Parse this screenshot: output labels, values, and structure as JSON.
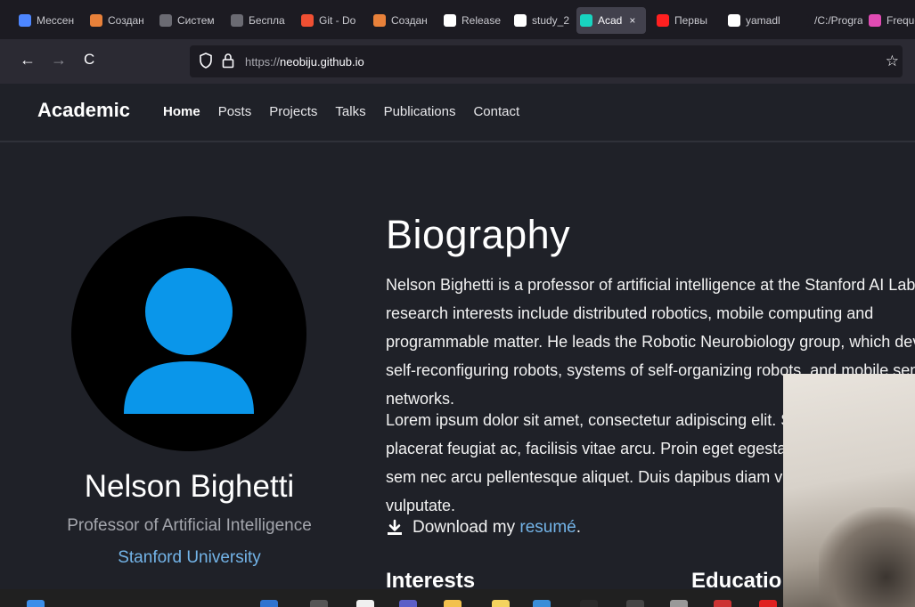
{
  "browser": {
    "tabs": [
      {
        "label": "Мессен",
        "color": "#4d86ff",
        "active": false
      },
      {
        "label": "Создан",
        "color": "#e8813a",
        "active": false
      },
      {
        "label": "Систем",
        "color": "#6b6b73",
        "active": false
      },
      {
        "label": "Беспла",
        "color": "#6b6b73",
        "active": false
      },
      {
        "label": "Git - Do",
        "color": "#f05033",
        "active": false
      },
      {
        "label": "Создан",
        "color": "#e8813a",
        "active": false
      },
      {
        "label": "Release",
        "color": "#ffffff",
        "active": false
      },
      {
        "label": "study_2",
        "color": "#ffffff",
        "active": false
      },
      {
        "label": "Acad",
        "color": "#18d4c0",
        "active": true
      },
      {
        "label": "Первы",
        "color": "#ff2020",
        "active": false
      },
      {
        "label": "yamadl",
        "color": "#ffffff",
        "active": false
      },
      {
        "label": "/C:/Progran",
        "color": "#1c1b22",
        "active": false
      },
      {
        "label": "Freque",
        "color": "#e04bb3",
        "active": false
      }
    ],
    "close_glyph": "×",
    "back_glyph": "←",
    "forward_glyph": "→",
    "reload_glyph": "C",
    "url_scheme": "https://",
    "url_host": "neobiju.github.io",
    "bookmark_glyph": "☆"
  },
  "site": {
    "brand": "Academic",
    "menu": [
      "Home",
      "Posts",
      "Projects",
      "Talks",
      "Publications",
      "Contact"
    ],
    "active_menu": "Home"
  },
  "profile": {
    "name": "Nelson Bighetti",
    "role": "Professor of Artificial Intelligence",
    "organization": "Stanford University",
    "avatar_bg": "#000000",
    "avatar_fg": "#0a96ea"
  },
  "biography": {
    "title": "Biography",
    "paragraph1": "Nelson Bighetti is a professor of artificial intelligence at the Stanford AI Lab. His research interests include distributed robotics, mobile computing and programmable matter. He leads the Robotic Neurobiology group, which develops self-reconfiguring robots, systems of self-organizing robots, and mobile sensor networks.",
    "paragraph2": "Lorem ipsum dolor sit amet, consectetur adipiscing elit. Sed neque elit, tristique placerat feugiat ac, facilisis vitae arcu. Proin eget egestas augue. Praesent ut sem nec arcu pellentesque aliquet. Duis dapibus diam vel metus tempus vulputate.",
    "download_prefix": "Download my",
    "download_link": "resumé",
    "download_suffix": ".",
    "interests_heading": "Interests",
    "education_heading": "Education"
  },
  "taskbar": {
    "icons": [
      "windows",
      "explorer",
      "search",
      "task-view",
      "chrome",
      "folder",
      "editor",
      "mail",
      "monitor",
      "app-dark",
      "app-grey",
      "pen",
      "app-red"
    ]
  }
}
